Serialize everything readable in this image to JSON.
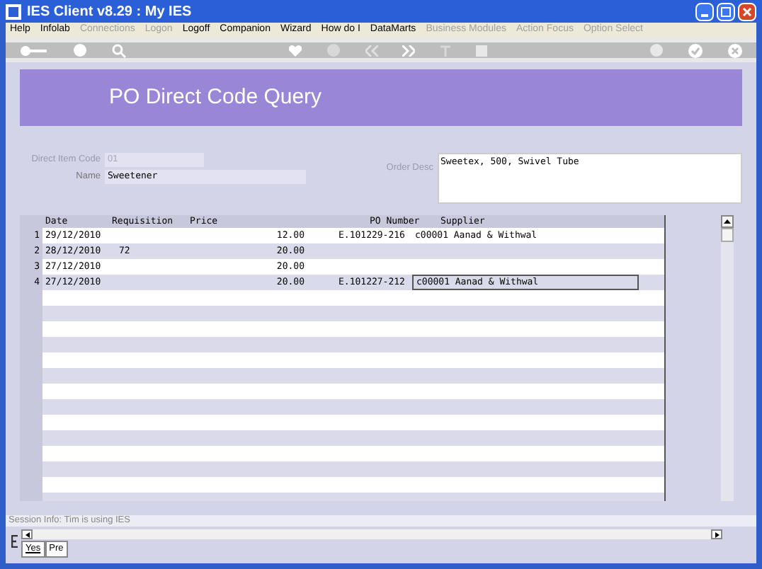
{
  "window": {
    "title": "IES Client v8.29 : My IES"
  },
  "menu": [
    {
      "label": "Help",
      "disabled": false
    },
    {
      "label": "Infolab",
      "disabled": false
    },
    {
      "label": "Connections",
      "disabled": true
    },
    {
      "label": "Logon",
      "disabled": true
    },
    {
      "label": "Logoff",
      "disabled": false
    },
    {
      "label": "Companion",
      "disabled": false
    },
    {
      "label": "Wizard",
      "disabled": false
    },
    {
      "label": "How do I",
      "disabled": false
    },
    {
      "label": "DataMarts",
      "disabled": false
    },
    {
      "label": "Business Modules",
      "disabled": true
    },
    {
      "label": "Action Focus",
      "disabled": true
    },
    {
      "label": "Option Select",
      "disabled": true
    }
  ],
  "page": {
    "title": "PO Direct Code Query"
  },
  "form": {
    "direct_item_code": {
      "label": "Direct Item Code",
      "value": "01"
    },
    "name": {
      "label": "Name",
      "value": "Sweetener"
    },
    "order_desc": {
      "label": "Order Desc",
      "value": "Sweetex, 500, Swivel Tube"
    }
  },
  "table": {
    "columns": [
      "Date",
      "Requisition",
      "Price",
      "PO Number",
      "Supplier"
    ],
    "rows": [
      {
        "number": "1",
        "date": "29/12/2010",
        "requisition": "",
        "price": "12.00",
        "po_number": "E.101229-216",
        "supplier": "c00001 Aanad & Withwal",
        "supplier_focused": false
      },
      {
        "number": "2",
        "date": "28/12/2010",
        "requisition": "72",
        "price": "20.00",
        "po_number": "",
        "supplier": "",
        "supplier_focused": false
      },
      {
        "number": "3",
        "date": "27/12/2010",
        "requisition": "",
        "price": "20.00",
        "po_number": "",
        "supplier": "",
        "supplier_focused": false
      },
      {
        "number": "4",
        "date": "27/12/2010",
        "requisition": "",
        "price": "20.00",
        "po_number": "E.101227-212",
        "supplier": "c00001 Aanad & Withwal",
        "supplier_focused": true
      }
    ]
  },
  "status_bar": {
    "text": "Session Info: Tim is using IES"
  },
  "bottom_tabs": [
    {
      "label": "Yes",
      "selected": true
    },
    {
      "label": "Pre",
      "selected": false
    }
  ]
}
